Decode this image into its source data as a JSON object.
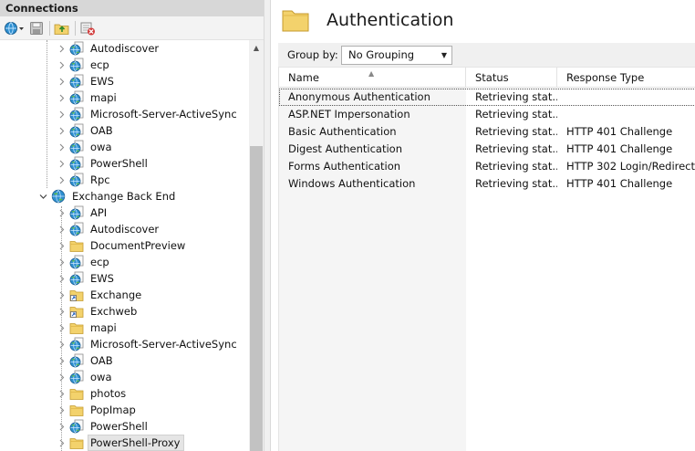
{
  "connections": {
    "title": "Connections",
    "tree": [
      {
        "label": "Autodiscover",
        "icon": "globe-page-icon",
        "level": 2
      },
      {
        "label": "ecp",
        "icon": "globe-page-icon",
        "level": 2
      },
      {
        "label": "EWS",
        "icon": "globe-page-icon",
        "level": 2
      },
      {
        "label": "mapi",
        "icon": "globe-page-icon",
        "level": 2
      },
      {
        "label": "Microsoft-Server-ActiveSync",
        "icon": "globe-page-icon",
        "level": 2
      },
      {
        "label": "OAB",
        "icon": "globe-page-icon",
        "level": 2
      },
      {
        "label": "owa",
        "icon": "globe-page-icon",
        "level": 2
      },
      {
        "label": "PowerShell",
        "icon": "globe-page-icon",
        "level": 2
      },
      {
        "label": "Rpc",
        "icon": "globe-page-icon",
        "level": 2
      },
      {
        "label": "Exchange Back End",
        "icon": "site-globe-icon",
        "level": 1,
        "expanded": true
      },
      {
        "label": "API",
        "icon": "globe-page-icon",
        "level": 2
      },
      {
        "label": "Autodiscover",
        "icon": "globe-page-icon",
        "level": 2
      },
      {
        "label": "DocumentPreview",
        "icon": "folder-icon",
        "level": 2
      },
      {
        "label": "ecp",
        "icon": "globe-page-icon",
        "level": 2
      },
      {
        "label": "EWS",
        "icon": "globe-page-icon",
        "level": 2
      },
      {
        "label": "Exchange",
        "icon": "virtual-dir-icon",
        "level": 2
      },
      {
        "label": "Exchweb",
        "icon": "virtual-dir-icon",
        "level": 2
      },
      {
        "label": "mapi",
        "icon": "folder-icon",
        "level": 2
      },
      {
        "label": "Microsoft-Server-ActiveSync",
        "icon": "globe-page-icon",
        "level": 2
      },
      {
        "label": "OAB",
        "icon": "globe-page-icon",
        "level": 2
      },
      {
        "label": "owa",
        "icon": "globe-page-icon",
        "level": 2
      },
      {
        "label": "photos",
        "icon": "folder-icon",
        "level": 2
      },
      {
        "label": "PopImap",
        "icon": "folder-icon",
        "level": 2
      },
      {
        "label": "PowerShell",
        "icon": "globe-page-icon",
        "level": 2
      },
      {
        "label": "PowerShell-Proxy",
        "icon": "folder-icon",
        "level": 2,
        "selected": true
      }
    ]
  },
  "main": {
    "title": "Authentication",
    "group_by": {
      "label": "Group by:",
      "value": "No Grouping"
    },
    "columns": [
      "Name",
      "Status",
      "Response Type"
    ],
    "rows": [
      {
        "name": "Anonymous Authentication",
        "status": "Retrieving stat...",
        "response": ""
      },
      {
        "name": "ASP.NET Impersonation",
        "status": "Retrieving stat...",
        "response": ""
      },
      {
        "name": "Basic Authentication",
        "status": "Retrieving stat...",
        "response": "HTTP 401 Challenge"
      },
      {
        "name": "Digest Authentication",
        "status": "Retrieving stat...",
        "response": "HTTP 401 Challenge"
      },
      {
        "name": "Forms Authentication",
        "status": "Retrieving stat...",
        "response": "HTTP 302 Login/Redirect"
      },
      {
        "name": "Windows Authentication",
        "status": "Retrieving stat...",
        "response": "HTTP 401 Challenge"
      }
    ]
  },
  "colors": {
    "folder": "#f3d26c",
    "globe": "#2e8fd0",
    "selection": "#e5e5e5"
  }
}
